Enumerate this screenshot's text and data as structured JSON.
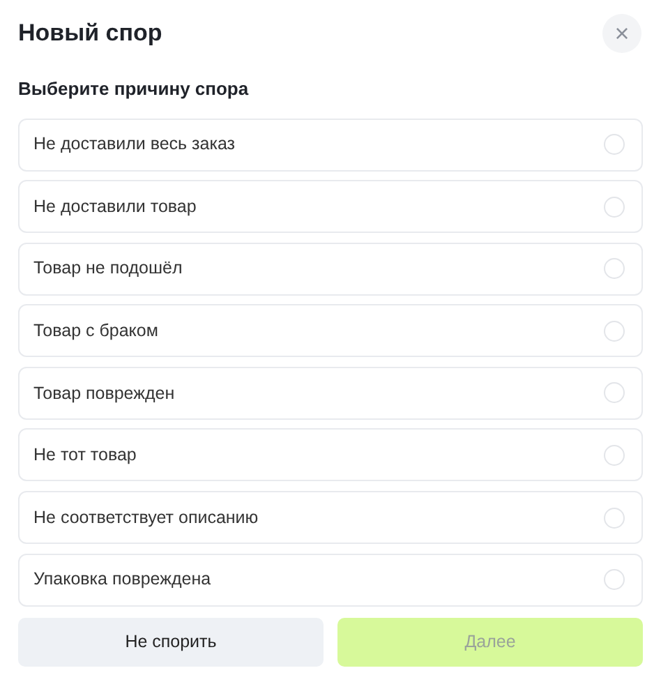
{
  "title": "Новый спор",
  "close": "×",
  "subtitle": "Выберите причину спора",
  "options": [
    {
      "label": "Не доставили весь заказ",
      "selected": false
    },
    {
      "label": "Не доставили товар",
      "selected": false
    },
    {
      "label": "Товар не подошёл",
      "selected": false
    },
    {
      "label": "Товар с браком",
      "selected": false
    },
    {
      "label": "Товар поврежден",
      "selected": false
    },
    {
      "label": "Не тот товар",
      "selected": false
    },
    {
      "label": "Не соответствует описанию",
      "selected": false
    },
    {
      "label": "Упаковка повреждена",
      "selected": false
    }
  ],
  "buttons": [
    {
      "label": "Не спорить",
      "kind": "secondary",
      "disabled": false
    },
    {
      "label": "Далее",
      "kind": "primary",
      "disabled": true
    }
  ]
}
